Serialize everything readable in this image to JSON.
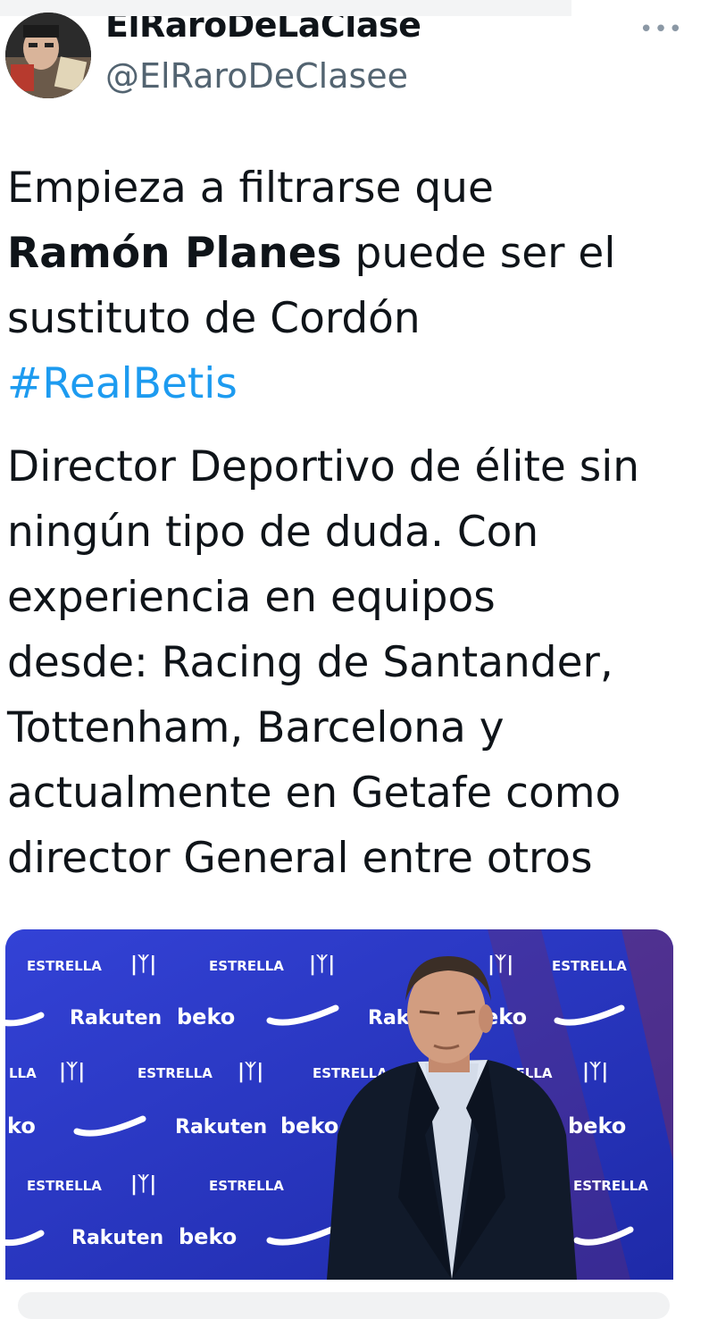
{
  "header": {
    "display_name": "ElRaroDeLaClase",
    "handle": "@ElRaroDeClasee",
    "more_icon": "more-horizontal-icon"
  },
  "tweet": {
    "line1": "Empieza a filtrarse que",
    "bold_name": "Ramón Planes",
    "line2_rest": " puede ser el",
    "line3": "sustituto de Cordón",
    "hashtag": "#RealBetis",
    "paragraph2": [
      "Director Deportivo de élite sin",
      "ningún tipo de duda. Con",
      "experiencia en equipos",
      "desde: Racing de Santander,",
      "Tottenham, Barcelona y",
      "actualmente en Getafe como",
      "director General entre otros"
    ]
  },
  "media": {
    "backdrop_logos": [
      "ESTRELLA",
      "Rakuten",
      "beko"
    ],
    "colors": {
      "backdrop": "#2a37c8",
      "suit": "#111a2a",
      "shirt": "#dfe6f2"
    }
  }
}
